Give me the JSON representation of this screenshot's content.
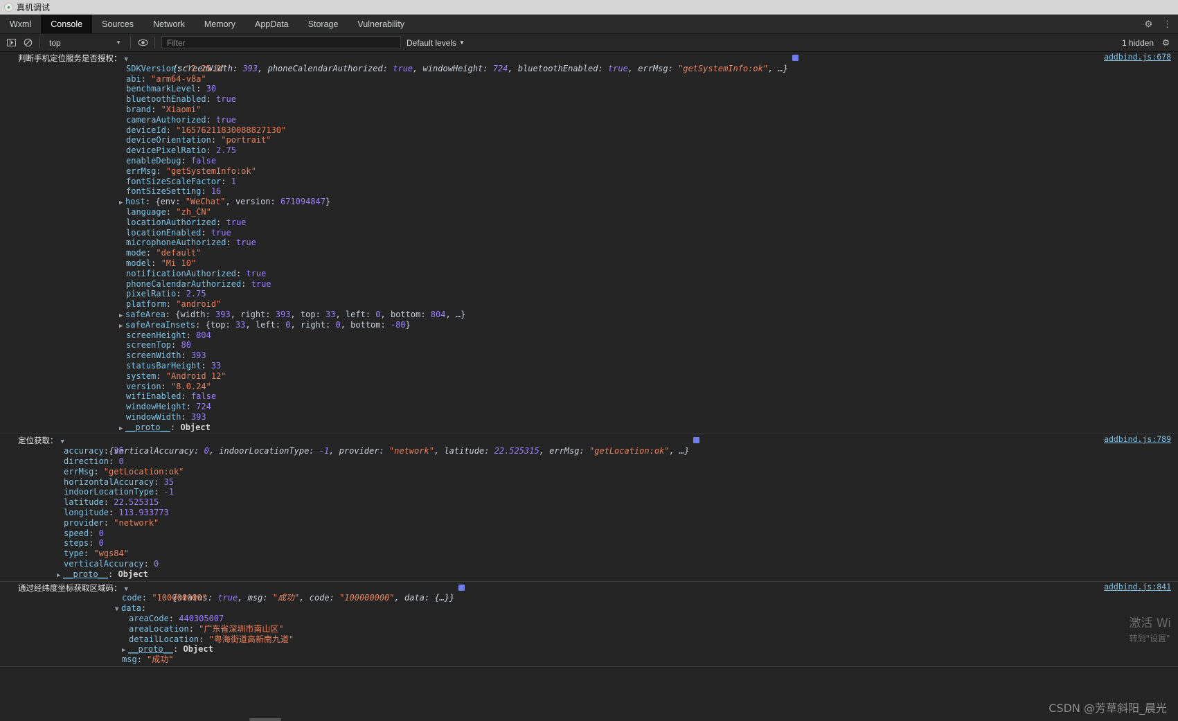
{
  "window": {
    "title": "真机调试",
    "logo_icon": "wechat-devtools-icon"
  },
  "tabs": [
    {
      "label": "Wxml",
      "active": false
    },
    {
      "label": "Console",
      "active": true
    },
    {
      "label": "Sources",
      "active": false
    },
    {
      "label": "Network",
      "active": false
    },
    {
      "label": "Memory",
      "active": false
    },
    {
      "label": "AppData",
      "active": false
    },
    {
      "label": "Storage",
      "active": false
    },
    {
      "label": "Vulnerability",
      "active": false
    }
  ],
  "tabstrip_icons": [
    {
      "name": "settings-gear-icon",
      "glyph": "⚙"
    },
    {
      "name": "more-vertical-icon",
      "glyph": "⋮"
    }
  ],
  "console_toolbar": {
    "sidebar_toggle_icon": "console-sidebar-icon",
    "clear_icon": "clear-console-icon",
    "context_value": "top",
    "context_caret": "▼",
    "eye_icon": "live-expression-icon",
    "filter_placeholder": "Filter",
    "filter_value": "",
    "levels_label": "Default levels",
    "levels_caret": "▼",
    "hidden_label": "1 hidden",
    "settings_icon": "console-settings-icon"
  },
  "logs": [
    {
      "label": "判断手机定位服务是否授权：",
      "source": "addbind.js:678",
      "preview": "{screenWidth: 393, phoneCalendarAuthorized: true, windowHeight: 724, bluetoothEnabled: true, errMsg: \"getSystemInfo:ok\", …}",
      "preview_parts": [
        {
          "t": "{",
          "c": "kd"
        },
        {
          "t": "screenWidth: ",
          "c": "kd"
        },
        {
          "t": "393",
          "c": "n"
        },
        {
          "t": ", phoneCalendarAuthorized: ",
          "c": "kd"
        },
        {
          "t": "true",
          "c": "b"
        },
        {
          "t": ", windowHeight: ",
          "c": "kd"
        },
        {
          "t": "724",
          "c": "n"
        },
        {
          "t": ", bluetoothEnabled: ",
          "c": "kd"
        },
        {
          "t": "true",
          "c": "b"
        },
        {
          "t": ", errMsg: ",
          "c": "kd"
        },
        {
          "t": "\"getSystemInfo:ok\"",
          "c": "s"
        },
        {
          "t": ", …}",
          "c": "kd"
        }
      ],
      "props": [
        {
          "key": "SDKVersion",
          "val": "\"2.25.0\"",
          "type": "s"
        },
        {
          "key": "abi",
          "val": "\"arm64-v8a\"",
          "type": "s"
        },
        {
          "key": "benchmarkLevel",
          "val": "30",
          "type": "n"
        },
        {
          "key": "bluetoothEnabled",
          "val": "true",
          "type": "b"
        },
        {
          "key": "brand",
          "val": "\"Xiaomi\"",
          "type": "s"
        },
        {
          "key": "cameraAuthorized",
          "val": "true",
          "type": "b"
        },
        {
          "key": "deviceId",
          "val": "\"16576211830088827130\"",
          "type": "s"
        },
        {
          "key": "deviceOrientation",
          "val": "\"portrait\"",
          "type": "s"
        },
        {
          "key": "devicePixelRatio",
          "val": "2.75",
          "type": "n"
        },
        {
          "key": "enableDebug",
          "val": "false",
          "type": "b"
        },
        {
          "key": "errMsg",
          "val": "\"getSystemInfo:ok\"",
          "type": "s"
        },
        {
          "key": "fontSizeScaleFactor",
          "val": "1",
          "type": "n"
        },
        {
          "key": "fontSizeSetting",
          "val": "16",
          "type": "n"
        },
        {
          "key": "host",
          "val": "{env: \"WeChat\", version: 671094847}",
          "type": "nested",
          "expandable": true
        },
        {
          "key": "language",
          "val": "\"zh_CN\"",
          "type": "s"
        },
        {
          "key": "locationAuthorized",
          "val": "true",
          "type": "b"
        },
        {
          "key": "locationEnabled",
          "val": "true",
          "type": "b"
        },
        {
          "key": "microphoneAuthorized",
          "val": "true",
          "type": "b"
        },
        {
          "key": "mode",
          "val": "\"default\"",
          "type": "s"
        },
        {
          "key": "model",
          "val": "\"Mi 10\"",
          "type": "s"
        },
        {
          "key": "notificationAuthorized",
          "val": "true",
          "type": "b"
        },
        {
          "key": "phoneCalendarAuthorized",
          "val": "true",
          "type": "b"
        },
        {
          "key": "pixelRatio",
          "val": "2.75",
          "type": "n"
        },
        {
          "key": "platform",
          "val": "\"android\"",
          "type": "s"
        },
        {
          "key": "safeArea",
          "val": "{width: 393, right: 393, top: 33, left: 0, bottom: 804, …}",
          "type": "nested",
          "expandable": true
        },
        {
          "key": "safeAreaInsets",
          "val": "{top: 33, left: 0, right: 0, bottom: -80}",
          "type": "nested",
          "expandable": true
        },
        {
          "key": "screenHeight",
          "val": "804",
          "type": "n"
        },
        {
          "key": "screenTop",
          "val": "80",
          "type": "n"
        },
        {
          "key": "screenWidth",
          "val": "393",
          "type": "n"
        },
        {
          "key": "statusBarHeight",
          "val": "33",
          "type": "n"
        },
        {
          "key": "system",
          "val": "\"Android 12\"",
          "type": "s"
        },
        {
          "key": "version",
          "val": "\"8.0.24\"",
          "type": "s"
        },
        {
          "key": "wifiEnabled",
          "val": "false",
          "type": "b"
        },
        {
          "key": "windowHeight",
          "val": "724",
          "type": "n"
        },
        {
          "key": "windowWidth",
          "val": "393",
          "type": "n"
        },
        {
          "key": "__proto__",
          "val": "Object",
          "type": "proto",
          "expandable": true
        }
      ]
    },
    {
      "label": "定位获取：",
      "source": "addbind.js:789",
      "preview": "{verticalAccuracy: 0, indoorLocationType: -1, provider: \"network\", latitude: 22.525315, errMsg: \"getLocation:ok\", …}",
      "preview_parts": [
        {
          "t": "{",
          "c": "kd"
        },
        {
          "t": "verticalAccuracy: ",
          "c": "kd"
        },
        {
          "t": "0",
          "c": "n"
        },
        {
          "t": ", indoorLocationType: ",
          "c": "kd"
        },
        {
          "t": "-1",
          "c": "n"
        },
        {
          "t": ", provider: ",
          "c": "kd"
        },
        {
          "t": "\"network\"",
          "c": "s"
        },
        {
          "t": ", latitude: ",
          "c": "kd"
        },
        {
          "t": "22.525315",
          "c": "n"
        },
        {
          "t": ", errMsg: ",
          "c": "kd"
        },
        {
          "t": "\"getLocation:ok\"",
          "c": "s"
        },
        {
          "t": ", …}",
          "c": "kd"
        }
      ],
      "props": [
        {
          "key": "accuracy",
          "val": "35",
          "type": "n"
        },
        {
          "key": "direction",
          "val": "0",
          "type": "n"
        },
        {
          "key": "errMsg",
          "val": "\"getLocation:ok\"",
          "type": "s"
        },
        {
          "key": "horizontalAccuracy",
          "val": "35",
          "type": "n"
        },
        {
          "key": "indoorLocationType",
          "val": "-1",
          "type": "n"
        },
        {
          "key": "latitude",
          "val": "22.525315",
          "type": "n"
        },
        {
          "key": "longitude",
          "val": "113.933773",
          "type": "n"
        },
        {
          "key": "provider",
          "val": "\"network\"",
          "type": "s"
        },
        {
          "key": "speed",
          "val": "0",
          "type": "n"
        },
        {
          "key": "steps",
          "val": "0",
          "type": "n"
        },
        {
          "key": "type",
          "val": "\"wgs84\"",
          "type": "s"
        },
        {
          "key": "verticalAccuracy",
          "val": "0",
          "type": "n"
        },
        {
          "key": "__proto__",
          "val": "Object",
          "type": "proto",
          "expandable": true
        }
      ]
    },
    {
      "label": "通过经纬度坐标获取区域码：",
      "source": "addbind.js:841",
      "preview": "{status: true, msg: \"成功\", code: \"100000000\", data: {…}}",
      "preview_parts": [
        {
          "t": "{",
          "c": "kd"
        },
        {
          "t": "status: ",
          "c": "kd"
        },
        {
          "t": "true",
          "c": "b"
        },
        {
          "t": ", msg: ",
          "c": "kd"
        },
        {
          "t": "\"成功\"",
          "c": "s"
        },
        {
          "t": ", code: ",
          "c": "kd"
        },
        {
          "t": "\"100000000\"",
          "c": "s"
        },
        {
          "t": ", data: {…}}",
          "c": "kd"
        }
      ],
      "props": [
        {
          "key": "code",
          "val": "\"100000000\"",
          "type": "s"
        },
        {
          "key": "data",
          "val": "",
          "type": "expanded-parent"
        },
        {
          "key": "areaCode",
          "val": "440305007",
          "type": "n",
          "depth": 2
        },
        {
          "key": "areaLocation",
          "val": "\"广东省深圳市南山区\"",
          "type": "s",
          "depth": 2
        },
        {
          "key": "detailLocation",
          "val": "\"粤海街道高新南九道\"",
          "type": "s",
          "depth": 2
        },
        {
          "key": "__proto__",
          "val": "Object",
          "type": "proto",
          "expandable": true,
          "depth": 2
        },
        {
          "key": "msg",
          "val": "\"成功\"",
          "type": "s"
        }
      ]
    }
  ],
  "watermarks": {
    "activate_line1": "激活 Wi",
    "activate_line2": "转到\"设置\"",
    "csdn": "CSDN @芳草斜阳_晨光"
  }
}
